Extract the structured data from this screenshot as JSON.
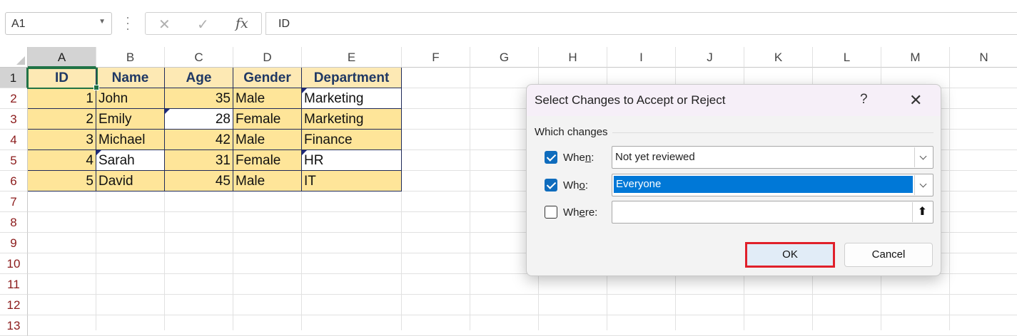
{
  "formula_bar": {
    "name_box": "A1",
    "cancel_glyph": "✕",
    "enter_glyph": "✓",
    "fx_label": "fx",
    "value": "ID"
  },
  "columns": [
    "A",
    "B",
    "C",
    "D",
    "E",
    "F",
    "G",
    "H",
    "I",
    "J",
    "K",
    "L",
    "M",
    "N"
  ],
  "rows": [
    "1",
    "2",
    "3",
    "4",
    "5",
    "6",
    "7",
    "8",
    "9",
    "10",
    "11",
    "12",
    "13"
  ],
  "table": {
    "headers": [
      "ID",
      "Name",
      "Age",
      "Gender",
      "Department"
    ],
    "rows": [
      [
        "1",
        "John",
        "35",
        "Male",
        "Marketing"
      ],
      [
        "2",
        "Emily",
        "28",
        "Female",
        "Marketing"
      ],
      [
        "3",
        "Michael",
        "42",
        "Male",
        "Finance"
      ],
      [
        "4",
        "Sarah",
        "31",
        "Female",
        "HR"
      ],
      [
        "5",
        "David",
        "45",
        "Male",
        "IT"
      ]
    ]
  },
  "dialog": {
    "title": "Select Changes to Accept or Reject",
    "help": "?",
    "close": "✕",
    "group_label": "Which changes",
    "when": {
      "label": "When:",
      "checked": true,
      "value": "Not yet reviewed"
    },
    "who": {
      "label": "Who:",
      "checked": true,
      "value": "Everyone"
    },
    "where": {
      "label": "Where:",
      "checked": false,
      "value": "",
      "picker_glyph": "⬆"
    },
    "ok_label": "OK",
    "cancel_label": "Cancel"
  },
  "colors": {
    "header_fill": "#fde9b4",
    "data_fill": "#fee599",
    "selection": "#217346",
    "accent": "#0f6cbd",
    "highlight_outline": "#e0202a"
  },
  "icons": [
    "name-box-dropdown-icon",
    "cancel-icon",
    "enter-icon",
    "function-icon",
    "help-icon",
    "close-icon",
    "checkmark-icon",
    "chevron-down-icon",
    "range-picker-icon"
  ]
}
